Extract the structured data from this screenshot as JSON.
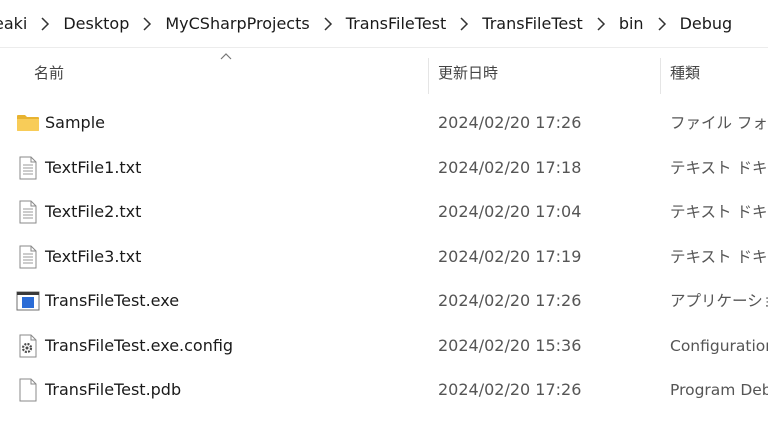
{
  "breadcrumb": {
    "items": [
      "eaki",
      "Desktop",
      "MyCSharpProjects",
      "TransFileTest",
      "TransFileTest",
      "bin",
      "Debug"
    ]
  },
  "header": {
    "name": "名前",
    "date": "更新日時",
    "type": "種類"
  },
  "rows": [
    {
      "name": "Sample",
      "date": "2024/02/20 17:26",
      "type": "ファイル フォルダー",
      "icon": "folder-icon"
    },
    {
      "name": "TextFile1.txt",
      "date": "2024/02/20 17:18",
      "type": "テキスト ドキュメント",
      "icon": "text-file-icon"
    },
    {
      "name": "TextFile2.txt",
      "date": "2024/02/20 17:04",
      "type": "テキスト ドキュメント",
      "icon": "text-file-icon"
    },
    {
      "name": "TextFile3.txt",
      "date": "2024/02/20 17:19",
      "type": "テキスト ドキュメント",
      "icon": "text-file-icon"
    },
    {
      "name": "TransFileTest.exe",
      "date": "2024/02/20 17:26",
      "type": "アプリケーション",
      "icon": "application-icon"
    },
    {
      "name": "TransFileTest.exe.config",
      "date": "2024/02/20 15:36",
      "type": "Configuration",
      "icon": "config-file-icon"
    },
    {
      "name": "TransFileTest.pdb",
      "date": "2024/02/20 17:26",
      "type": "Program Debug",
      "icon": "blank-file-icon"
    }
  ],
  "colors": {
    "folder": "#f5c542",
    "exe_blue": "#2b6cd6"
  }
}
